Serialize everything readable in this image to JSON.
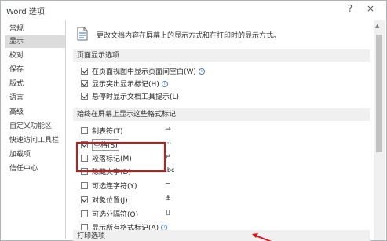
{
  "window": {
    "title": "Word 选项"
  },
  "titlebar": {
    "help_label": "?",
    "close_label": "×"
  },
  "sidebar": {
    "items": [
      {
        "label": "常规"
      },
      {
        "label": "显示",
        "active": true
      },
      {
        "label": "校对"
      },
      {
        "label": "保存"
      },
      {
        "label": "版式"
      },
      {
        "label": "语言"
      },
      {
        "label": "高级"
      },
      {
        "label": "自定义功能区"
      },
      {
        "label": "快速访问工具栏"
      },
      {
        "label": "加载项"
      },
      {
        "label": "信任中心"
      }
    ]
  },
  "content": {
    "header_text": "更改文档内容在屏幕上的显示方式和在打印时的显示方式。",
    "page_display": {
      "title": "页面显示选项",
      "options": [
        {
          "label": "在页面视图中显示页面间空白(W)",
          "checked": true
        },
        {
          "label": "显示突出显示标记(H)",
          "checked": true
        },
        {
          "label": "悬停时显示文档工具提示(L)",
          "checked": true
        }
      ]
    },
    "formatting_marks": {
      "title": "始终在屏幕上显示这些格式标记",
      "options": [
        {
          "label": "制表符(T)",
          "checked": false,
          "symbol": "→"
        },
        {
          "label": "空格(S)",
          "checked": true,
          "symbol": "···"
        },
        {
          "label": "段落标记(M)",
          "checked": false,
          "symbol": "↵"
        },
        {
          "label": "隐藏文字(D)",
          "checked": false,
          "symbol": "abc"
        },
        {
          "label": "可选连字符(Y)",
          "checked": false,
          "symbol": "¬"
        },
        {
          "label": "对象位置(J)",
          "checked": true,
          "symbol": "⚓"
        },
        {
          "label": "可选分隔符(O)",
          "checked": false,
          "symbol": "▯"
        },
        {
          "label": "显示所有格式标记(A)",
          "checked": false
        }
      ]
    },
    "print": {
      "title": "打印选项"
    }
  }
}
